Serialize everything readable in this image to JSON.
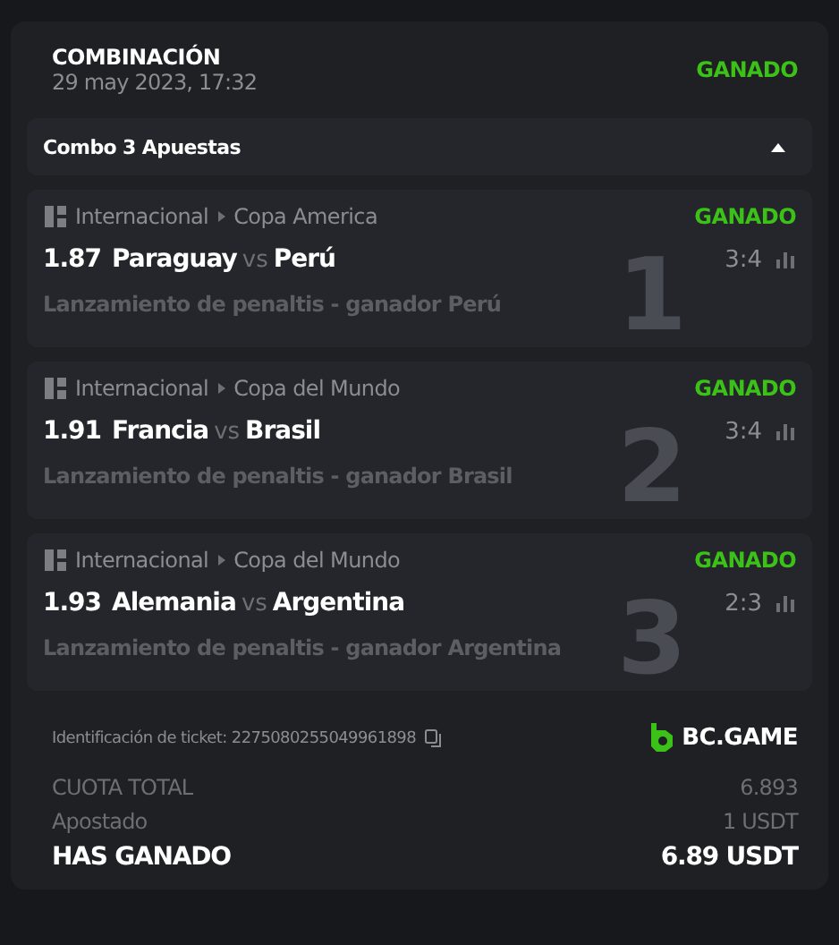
{
  "header": {
    "title": "COMBINACIÓN",
    "date": "29 may 2023, 17:32",
    "status": "GANADO"
  },
  "combo": {
    "label": "Combo 3 Apuestas",
    "expanded": true
  },
  "bets": [
    {
      "number": "1",
      "league": "Internacional",
      "tournament": "Copa America",
      "status": "GANADO",
      "odds": "1.87",
      "home": "Paraguay",
      "vs": "vs",
      "away": "Perú",
      "score": "3:4",
      "market": "Lanzamiento de penaltis - ganador Perú"
    },
    {
      "number": "2",
      "league": "Internacional",
      "tournament": "Copa del Mundo",
      "status": "GANADO",
      "odds": "1.91",
      "home": "Francia",
      "vs": "vs",
      "away": "Brasil",
      "score": "3:4",
      "market": "Lanzamiento de penaltis - ganador Brasil"
    },
    {
      "number": "3",
      "league": "Internacional",
      "tournament": "Copa del Mundo",
      "status": "GANADO",
      "odds": "1.93",
      "home": "Alemania",
      "vs": "vs",
      "away": "Argentina",
      "score": "2:3",
      "market": "Lanzamiento de penaltis - ganador Argentina"
    }
  ],
  "ticket": {
    "label": "Identificación de ticket: 2275080255049961898",
    "brand": "BC.GAME"
  },
  "totals": [
    {
      "kind": "plain",
      "label": "CUOTA TOTAL",
      "value": "6.893"
    },
    {
      "kind": "plain",
      "label": "Apostado",
      "value": "1 USDT"
    },
    {
      "kind": "strong",
      "label": "HAS GANADO",
      "value": "6.89 USDT"
    }
  ]
}
